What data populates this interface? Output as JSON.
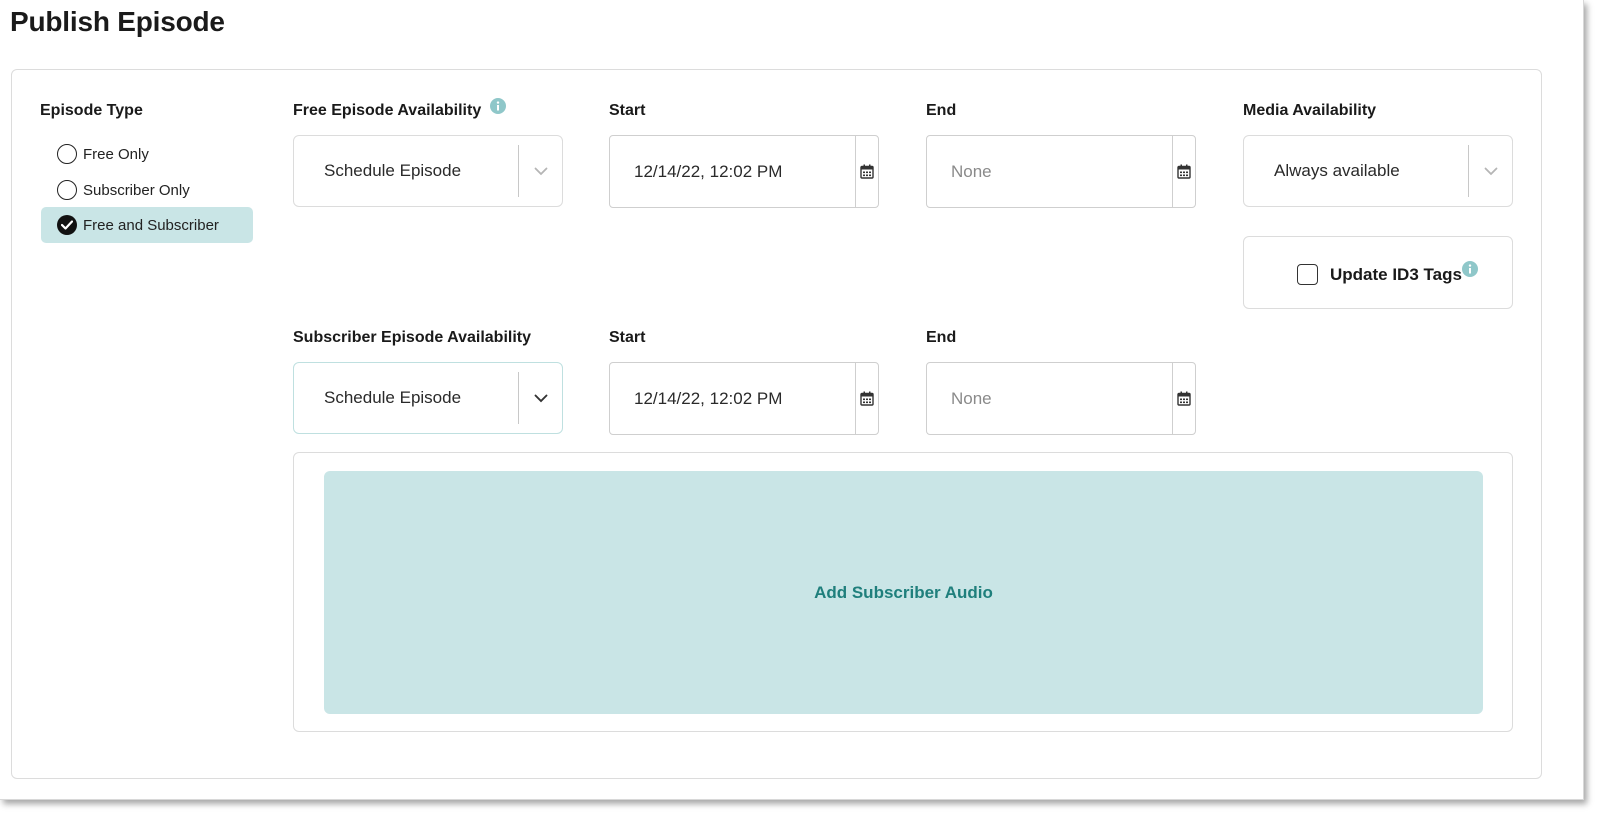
{
  "page": {
    "title": "Publish Episode"
  },
  "episode_type": {
    "label": "Episode Type",
    "options": [
      {
        "label": "Free Only",
        "selected": false
      },
      {
        "label": "Subscriber Only",
        "selected": false
      },
      {
        "label": "Free and Subscriber",
        "selected": true
      }
    ]
  },
  "free": {
    "availability_label": "Free Episode Availability",
    "availability_value": "Schedule Episode",
    "start_label": "Start",
    "start_value": "12/14/22, 12:02 PM",
    "end_label": "End",
    "end_placeholder": "None"
  },
  "media": {
    "label": "Media Availability",
    "value": "Always available"
  },
  "id3": {
    "label": "Update ID3 Tags",
    "checked": false
  },
  "subscriber": {
    "availability_label": "Subscriber Episode Availability",
    "availability_value": "Schedule Episode",
    "start_label": "Start",
    "start_value": "12/14/22, 12:02 PM",
    "end_label": "End",
    "end_placeholder": "None"
  },
  "audio": {
    "label": "Add Subscriber Audio"
  },
  "colors": {
    "accent_bg": "#c9e5e6",
    "accent_text": "#1f7f7c",
    "info_icon": "#8fc7c9"
  }
}
